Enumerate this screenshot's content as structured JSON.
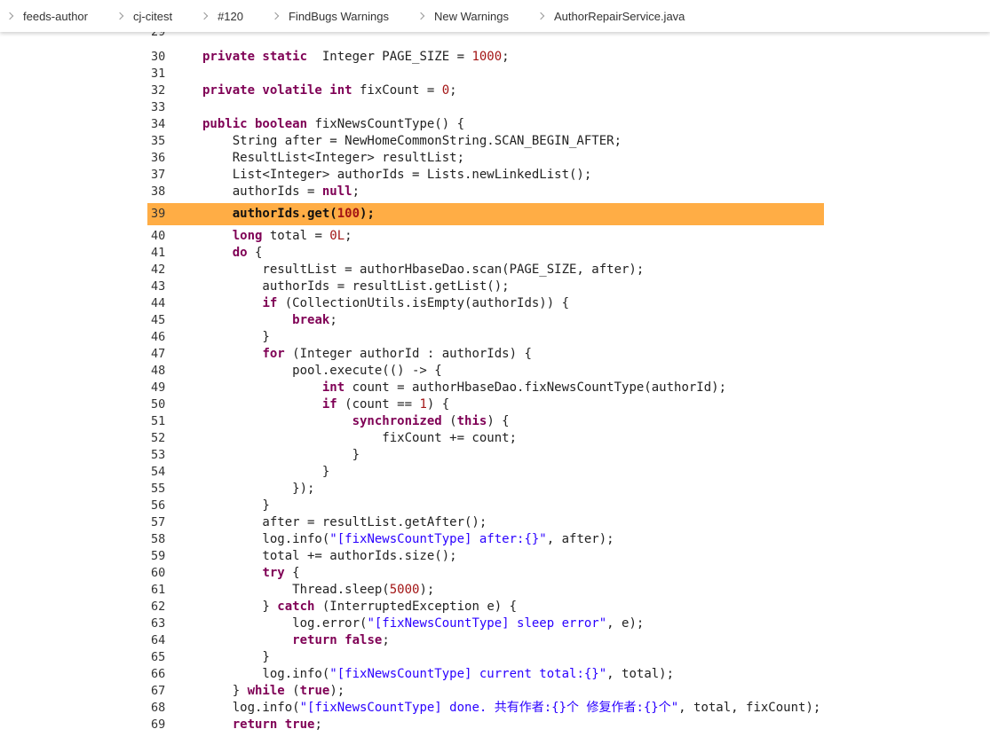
{
  "breadcrumb": {
    "items": [
      {
        "label": "feeds-author"
      },
      {
        "label": "cj-citest"
      },
      {
        "label": "#120"
      },
      {
        "label": "FindBugs Warnings"
      },
      {
        "label": "New Warnings"
      },
      {
        "label": "AuthorRepairService.java"
      }
    ]
  },
  "source": {
    "highlighted_line": 39,
    "highlight_color": "#ffad45",
    "lines": [
      {
        "n": "29",
        "tokens": []
      },
      {
        "n": "30",
        "tokens": [
          [
            "kw",
            "private static"
          ],
          [
            "",
            "  Integer PAGE_SIZE = "
          ],
          [
            "num",
            "1000"
          ],
          [
            "",
            ";"
          ]
        ]
      },
      {
        "n": "31",
        "tokens": []
      },
      {
        "n": "32",
        "tokens": [
          [
            "kw",
            "private volatile int"
          ],
          [
            "",
            " fixCount = "
          ],
          [
            "num",
            "0"
          ],
          [
            "",
            ";"
          ]
        ]
      },
      {
        "n": "33",
        "tokens": []
      },
      {
        "n": "34",
        "tokens": [
          [
            "kw",
            "public boolean"
          ],
          [
            "",
            " fixNewsCountType() {"
          ]
        ]
      },
      {
        "n": "35",
        "tokens": [
          [
            "",
            "    String after = NewHomeCommonString.SCAN_BEGIN_AFTER;"
          ]
        ]
      },
      {
        "n": "36",
        "tokens": [
          [
            "",
            "    ResultList<Integer> resultList;"
          ]
        ]
      },
      {
        "n": "37",
        "tokens": [
          [
            "",
            "    List<Integer> authorIds = Lists.newLinkedList();"
          ]
        ]
      },
      {
        "n": "38",
        "tokens": [
          [
            "",
            "    authorIds = "
          ],
          [
            "kw",
            "null"
          ],
          [
            "",
            ";"
          ]
        ]
      },
      {
        "n": "39",
        "tokens": [
          [
            "",
            "    authorIds.get("
          ],
          [
            "num",
            "100"
          ],
          [
            "",
            ");"
          ]
        ]
      },
      {
        "n": "40",
        "tokens": [
          [
            "",
            "    "
          ],
          [
            "kw",
            "long"
          ],
          [
            "",
            " total = "
          ],
          [
            "num",
            "0L"
          ],
          [
            "",
            ";"
          ]
        ]
      },
      {
        "n": "41",
        "tokens": [
          [
            "",
            "    "
          ],
          [
            "kw",
            "do"
          ],
          [
            "",
            " {"
          ]
        ]
      },
      {
        "n": "42",
        "tokens": [
          [
            "",
            "        resultList = authorHbaseDao.scan(PAGE_SIZE, after);"
          ]
        ]
      },
      {
        "n": "43",
        "tokens": [
          [
            "",
            "        authorIds = resultList.getList();"
          ]
        ]
      },
      {
        "n": "44",
        "tokens": [
          [
            "",
            "        "
          ],
          [
            "kw",
            "if"
          ],
          [
            "",
            " (CollectionUtils.isEmpty(authorIds)) {"
          ]
        ]
      },
      {
        "n": "45",
        "tokens": [
          [
            "",
            "            "
          ],
          [
            "kw",
            "break"
          ],
          [
            "",
            ";"
          ]
        ]
      },
      {
        "n": "46",
        "tokens": [
          [
            "",
            "        }"
          ]
        ]
      },
      {
        "n": "47",
        "tokens": [
          [
            "",
            "        "
          ],
          [
            "kw",
            "for"
          ],
          [
            "",
            " (Integer authorId : authorIds) {"
          ]
        ]
      },
      {
        "n": "48",
        "tokens": [
          [
            "",
            "            pool.execute(() -> {"
          ]
        ]
      },
      {
        "n": "49",
        "tokens": [
          [
            "",
            "                "
          ],
          [
            "kw",
            "int"
          ],
          [
            "",
            " count = authorHbaseDao.fixNewsCountType(authorId);"
          ]
        ]
      },
      {
        "n": "50",
        "tokens": [
          [
            "",
            "                "
          ],
          [
            "kw",
            "if"
          ],
          [
            "",
            " (count == "
          ],
          [
            "num",
            "1"
          ],
          [
            "",
            ") {"
          ]
        ]
      },
      {
        "n": "51",
        "tokens": [
          [
            "",
            "                    "
          ],
          [
            "kw",
            "synchronized"
          ],
          [
            "",
            " ("
          ],
          [
            "kw",
            "this"
          ],
          [
            "",
            ") {"
          ]
        ]
      },
      {
        "n": "52",
        "tokens": [
          [
            "",
            "                        fixCount += count;"
          ]
        ]
      },
      {
        "n": "53",
        "tokens": [
          [
            "",
            "                    }"
          ]
        ]
      },
      {
        "n": "54",
        "tokens": [
          [
            "",
            "                }"
          ]
        ]
      },
      {
        "n": "55",
        "tokens": [
          [
            "",
            "            });"
          ]
        ]
      },
      {
        "n": "56",
        "tokens": [
          [
            "",
            "        }"
          ]
        ]
      },
      {
        "n": "57",
        "tokens": [
          [
            "",
            "        after = resultList.getAfter();"
          ]
        ]
      },
      {
        "n": "58",
        "tokens": [
          [
            "",
            "        log.info("
          ],
          [
            "str",
            "\"[fixNewsCountType] after:{}\""
          ],
          [
            "",
            ", after);"
          ]
        ]
      },
      {
        "n": "59",
        "tokens": [
          [
            "",
            "        total += authorIds.size();"
          ]
        ]
      },
      {
        "n": "60",
        "tokens": [
          [
            "",
            "        "
          ],
          [
            "kw",
            "try"
          ],
          [
            "",
            " {"
          ]
        ]
      },
      {
        "n": "61",
        "tokens": [
          [
            "",
            "            Thread.sleep("
          ],
          [
            "num",
            "5000"
          ],
          [
            "",
            ");"
          ]
        ]
      },
      {
        "n": "62",
        "tokens": [
          [
            "",
            "        } "
          ],
          [
            "kw",
            "catch"
          ],
          [
            "",
            " (InterruptedException e) {"
          ]
        ]
      },
      {
        "n": "63",
        "tokens": [
          [
            "",
            "            log.error("
          ],
          [
            "str",
            "\"[fixNewsCountType] sleep error\""
          ],
          [
            "",
            ", e);"
          ]
        ]
      },
      {
        "n": "64",
        "tokens": [
          [
            "",
            "            "
          ],
          [
            "kw",
            "return false"
          ],
          [
            "",
            ";"
          ]
        ]
      },
      {
        "n": "65",
        "tokens": [
          [
            "",
            "        }"
          ]
        ]
      },
      {
        "n": "66",
        "tokens": [
          [
            "",
            "        log.info("
          ],
          [
            "str",
            "\"[fixNewsCountType] current total:{}\""
          ],
          [
            "",
            ", total);"
          ]
        ]
      },
      {
        "n": "67",
        "tokens": [
          [
            "",
            "    } "
          ],
          [
            "kw",
            "while"
          ],
          [
            "",
            " ("
          ],
          [
            "kw",
            "true"
          ],
          [
            "",
            ");"
          ]
        ]
      },
      {
        "n": "68",
        "tokens": [
          [
            "",
            "    log.info("
          ],
          [
            "str",
            "\"[fixNewsCountType] done. 共有作者:{}个 修复作者:{}个\""
          ],
          [
            "",
            ", total, fixCount);"
          ]
        ]
      },
      {
        "n": "69",
        "tokens": [
          [
            "",
            "    "
          ],
          [
            "kw",
            "return true"
          ],
          [
            "",
            ";"
          ]
        ]
      }
    ]
  }
}
